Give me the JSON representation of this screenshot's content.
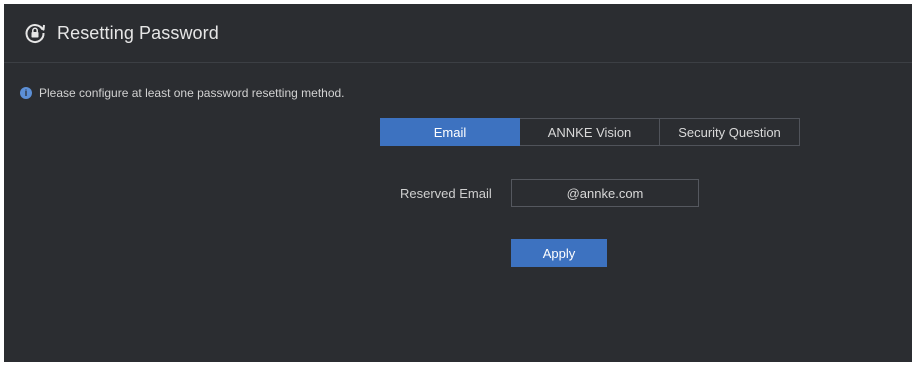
{
  "header": {
    "title": "Resetting Password",
    "icon": "lock-reset-icon"
  },
  "notice": {
    "icon": "info-icon",
    "text": "Please configure at least one password resetting method."
  },
  "tabs": [
    {
      "label": "Email",
      "active": true
    },
    {
      "label": "ANNKE Vision",
      "active": false
    },
    {
      "label": "Security Question",
      "active": false
    }
  ],
  "form": {
    "reserved_email_label": "Reserved Email",
    "reserved_email_value": "@annke.com"
  },
  "actions": {
    "apply_label": "Apply"
  },
  "colors": {
    "background": "#2b2d31",
    "accent": "#3d72c0",
    "text": "#d9d9d9"
  }
}
